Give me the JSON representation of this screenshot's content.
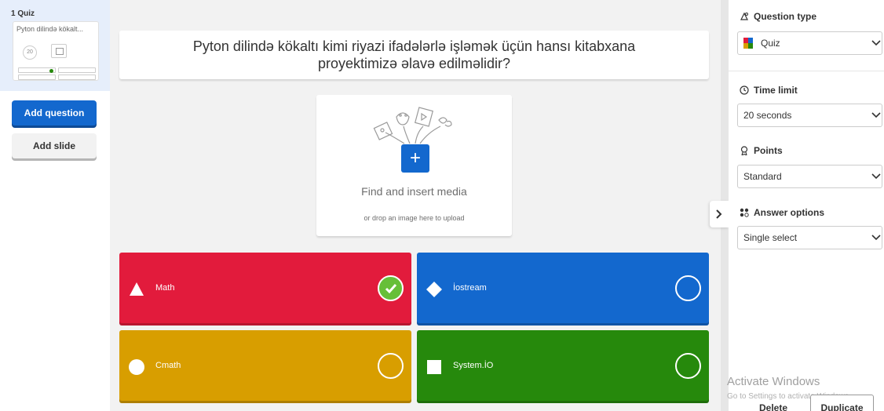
{
  "sidebar": {
    "slide_number_label": "1  Quiz",
    "thumb_title": "Pyton dilində kökalt...",
    "thumb_timer": "20",
    "add_question_label": "Add question",
    "add_slide_label": "Add slide"
  },
  "editor": {
    "question_text": "Pyton dilində kökaltı kimi riyazi ifadələrlə işləmək üçün hansı kitabxana proyektimizə əlavə edilməlidir?",
    "media_title": "Find and insert media",
    "media_subtitle": "or drop an image here to upload",
    "media_add_icon": "+"
  },
  "answers": [
    {
      "text": "Math",
      "shape": "triangle",
      "color": "#e21b3c",
      "correct": true
    },
    {
      "text": "İostream",
      "shape": "diamond",
      "color": "#1368ce",
      "correct": false
    },
    {
      "text": "Cmath",
      "shape": "circle",
      "color": "#d89e00",
      "correct": false
    },
    {
      "text": "System.İO",
      "shape": "square",
      "color": "#26890c",
      "correct": false
    }
  ],
  "settings": {
    "question_type_title": "Question type",
    "question_type_value": "Quiz",
    "time_limit_title": "Time limit",
    "time_limit_value": "20 seconds",
    "points_title": "Points",
    "points_value": "Standard",
    "answer_options_title": "Answer options",
    "answer_options_value": "Single select"
  },
  "footer": {
    "watermark_title": "Activate Windows",
    "watermark_sub": "Go to Settings to activate Windows.",
    "delete_label": "Delete",
    "duplicate_label": "Duplicate"
  },
  "icons": {
    "question_type": "shapes-icon",
    "time_limit": "clock-icon",
    "points": "medal-icon",
    "answer_options": "grid-dots-icon",
    "collapse": "chevron-right-icon"
  }
}
